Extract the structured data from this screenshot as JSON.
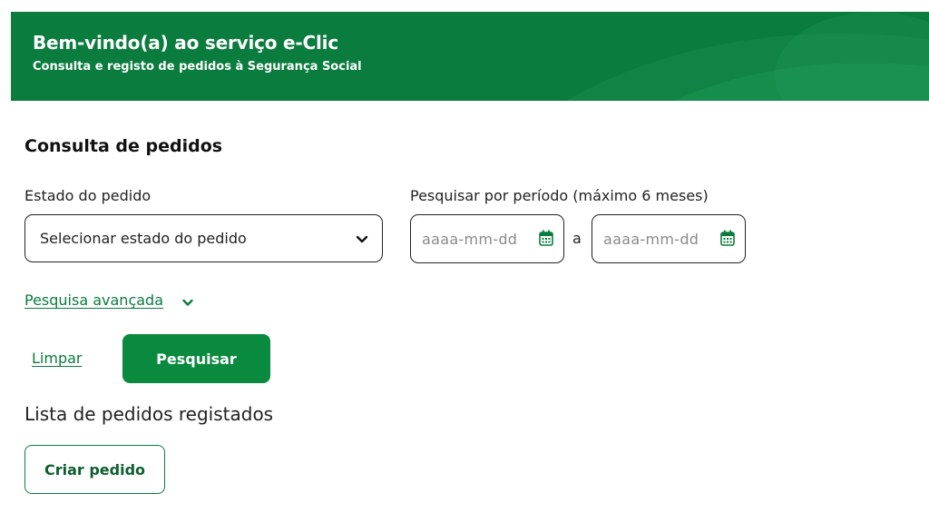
{
  "banner": {
    "title": "Bem-vindo(a) ao serviço e-Clic",
    "subtitle": "Consulta e registo de pedidos à Segurança Social"
  },
  "form": {
    "section_title": "Consulta de pedidos",
    "status_label": "Estado do pedido",
    "status_value": "Selecionar estado do pedido",
    "period_label": "Pesquisar por período (máximo 6 meses)",
    "date_from_placeholder": "aaaa-mm-dd",
    "date_to_placeholder": "aaaa-mm-dd",
    "range_separator": "a",
    "advanced_search_label": "Pesquisa avançada",
    "clear_label": "Limpar",
    "search_label": "Pesquisar"
  },
  "list": {
    "title": "Lista de pedidos registados",
    "create_label": "Criar pedido"
  },
  "icons": {
    "select_chevron": "chevron-down-icon",
    "date_from": "calendar-icon",
    "date_to": "calendar-icon",
    "advanced_chevron": "chevron-down-icon"
  },
  "colors": {
    "brand_green": "#0a7c3e",
    "button_green": "#0a8a3e",
    "text": "#222222",
    "placeholder": "#8a8a8a"
  }
}
